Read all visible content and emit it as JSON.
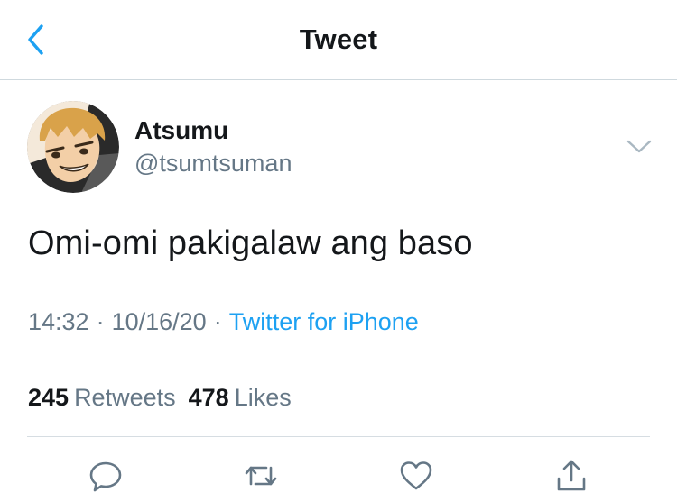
{
  "header": {
    "title": "Tweet",
    "back_icon": "chevron-left-icon"
  },
  "author": {
    "display_name": "Atsumu",
    "handle": "@tsumtsuman"
  },
  "tweet": {
    "text": "Omi-omi pakigalaw ang baso",
    "time": "14:32",
    "date": "10/16/20",
    "separator": "·",
    "source": "Twitter for iPhone"
  },
  "stats": {
    "retweets_count": "245",
    "retweets_label": "Retweets",
    "likes_count": "478",
    "likes_label": "Likes"
  },
  "actions": [
    "reply-icon",
    "retweet-icon",
    "like-icon",
    "share-icon"
  ],
  "colors": {
    "accent": "#1da1f2",
    "secondary_text": "#657786",
    "icon_gray": "#657786",
    "back_chevron": "#1da1f2"
  }
}
